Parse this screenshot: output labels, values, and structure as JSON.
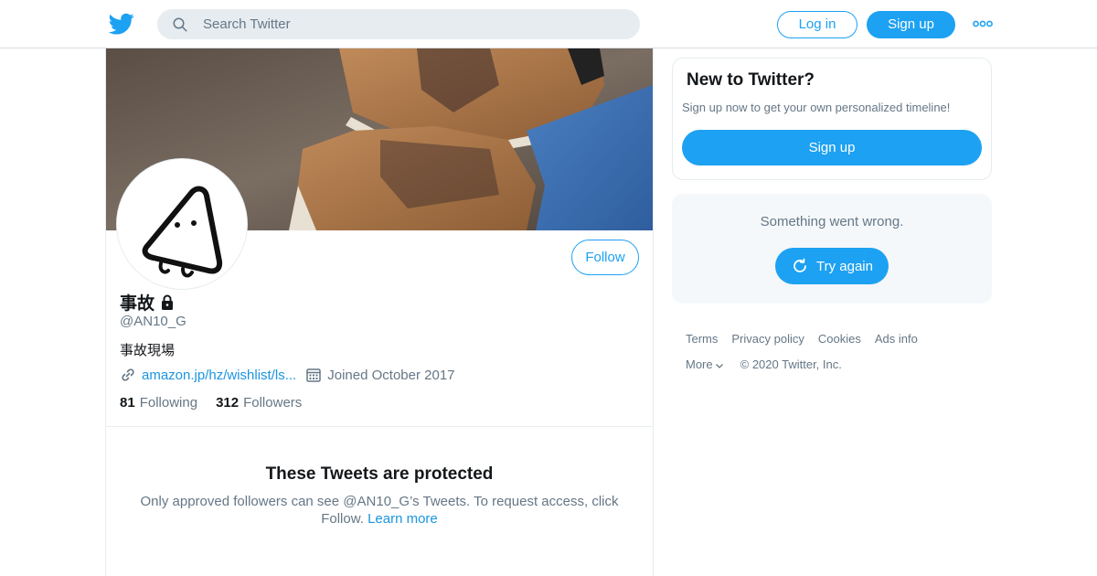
{
  "header": {
    "search_placeholder": "Search Twitter",
    "login_label": "Log in",
    "signup_label": "Sign up",
    "brand_color": "#1da1f2"
  },
  "profile": {
    "display_name": "事故",
    "handle": "@AN10_G",
    "bio": "事故現場",
    "url_text": "amazon.jp/hz/wishlist/ls...",
    "joined": "Joined October 2017",
    "following_count": "81",
    "following_label": "Following",
    "followers_count": "312",
    "followers_label": "Followers",
    "follow_label": "Follow",
    "protected": true,
    "icons": {
      "lock": "lock-icon",
      "link": "link-icon",
      "calendar": "calendar-icon"
    }
  },
  "protected_notice": {
    "title": "These Tweets are protected",
    "text": "Only approved followers can see @AN10_G’s Tweets. To request access, click Follow.",
    "link_text": "Learn more"
  },
  "sidebar": {
    "new_card": {
      "title": "New to Twitter?",
      "subtitle": "Sign up now to get your own personalized timeline!",
      "button_label": "Sign up"
    },
    "error_card": {
      "text": "Something went wrong.",
      "button_label": "Try again"
    },
    "footer": {
      "links": [
        "Terms",
        "Privacy policy",
        "Cookies",
        "Ads info"
      ],
      "more_label": "More",
      "copyright": "© 2020 Twitter, Inc."
    }
  }
}
